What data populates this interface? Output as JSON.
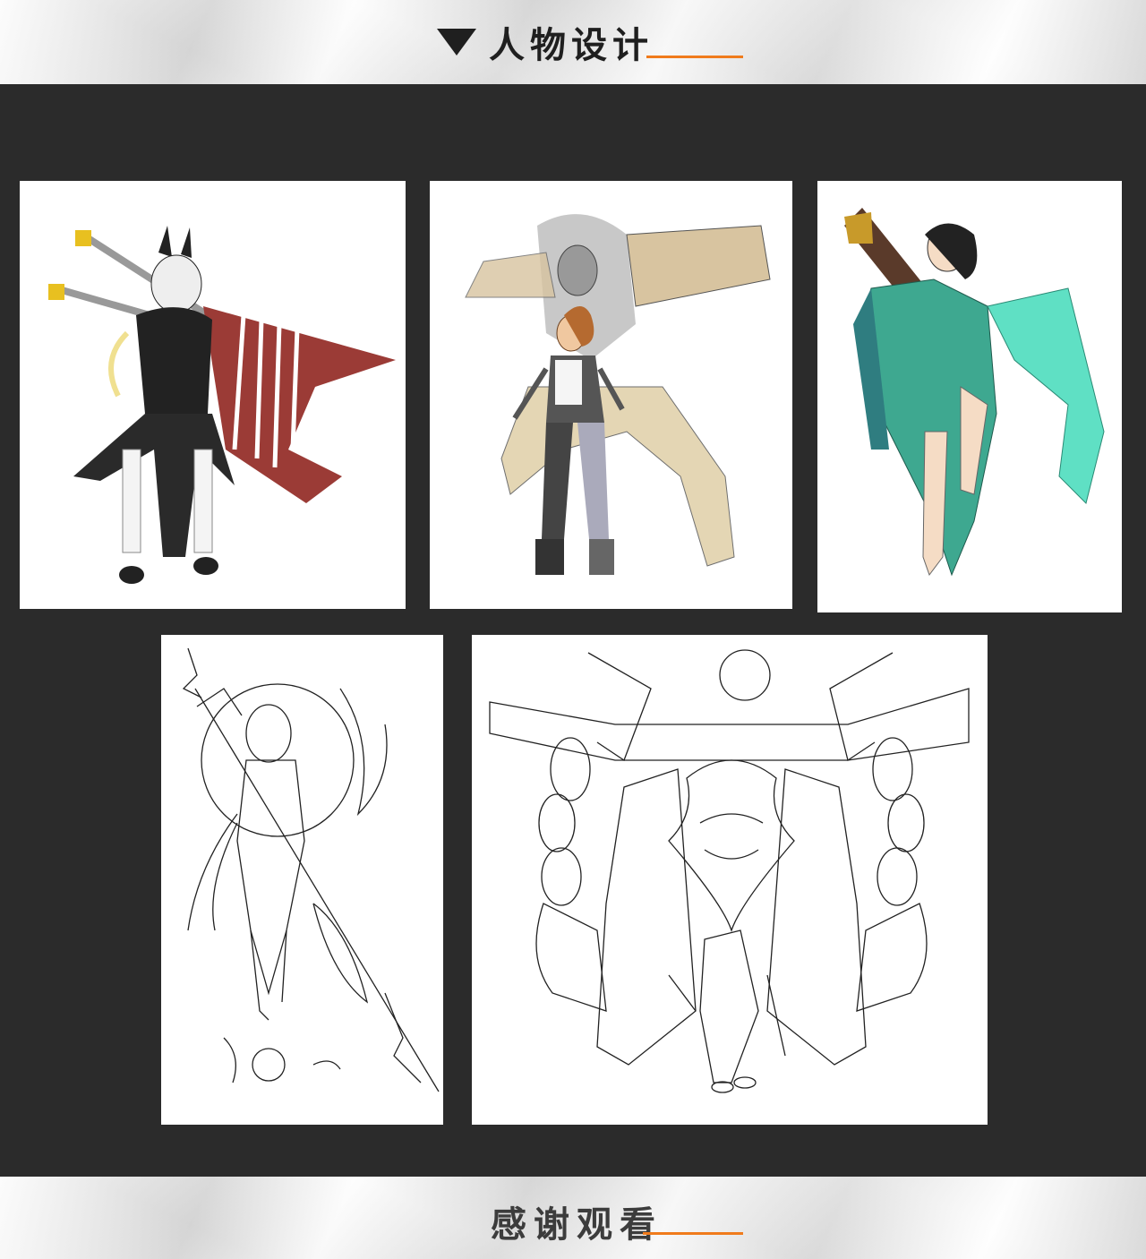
{
  "header": {
    "title": "人物设计",
    "icon": "triangle-down-icon",
    "accent_color": "#f07b1c"
  },
  "gallery": {
    "background": "#2b2b2b",
    "items": [
      {
        "name": "bunny-nun-swordswoman",
        "style": "color"
      },
      {
        "name": "steampunk-mechanic-girl",
        "style": "color sketch"
      },
      {
        "name": "guqin-fairy",
        "style": "color"
      },
      {
        "name": "spear-warrior-lineart",
        "style": "line art"
      },
      {
        "name": "chained-demon-lineart",
        "style": "line art"
      }
    ]
  },
  "footer": {
    "text": "感谢观看"
  }
}
